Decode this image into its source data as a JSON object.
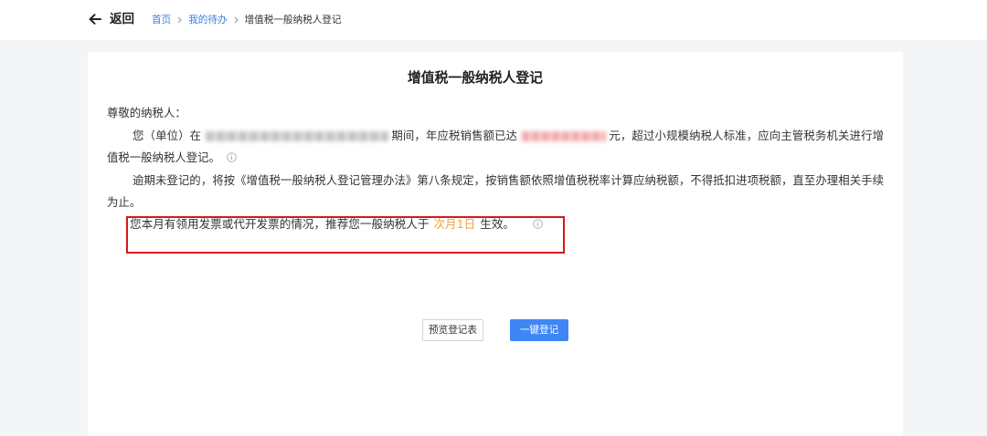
{
  "header": {
    "back_label": "返回",
    "breadcrumb": [
      {
        "label": "首页"
      },
      {
        "label": "我的待办"
      },
      {
        "label": "增值税一般纳税人登记"
      }
    ]
  },
  "notice": {
    "title": "增值税一般纳税人登记",
    "greeting": "尊敬的纳税人：",
    "paragraph1": {
      "part1": "您（单位）在",
      "part2": "期间，年应税销售额已达",
      "part3": "元，超过小规模纳税人标准，应向主管税务机关进行增值税一般纳税人登记。"
    },
    "paragraph2": "逾期未登记的，将按《增值税一般纳税人登记管理办法》第八条规定，按销售额依照增值税税率计算应纳税额，不得抵扣进项税额，直至办理相关手续为止。",
    "effective": {
      "prefix": "您本月有领用发票或代开发票的情况，推荐您一般纳税人于",
      "date": "次月1日",
      "suffix": "生效。"
    }
  },
  "actions": {
    "preview_label": "预览登记表",
    "register_label": "一键登记"
  },
  "icons": {
    "back": "arrow-left-icon",
    "separator": "chevron-right-icon",
    "info": "info-icon"
  },
  "colors": {
    "accent": "#3f86f5",
    "link": "#3b7fe0",
    "highlight": "#f0a23b",
    "annotation": "#d7161b",
    "text": "#333333"
  }
}
